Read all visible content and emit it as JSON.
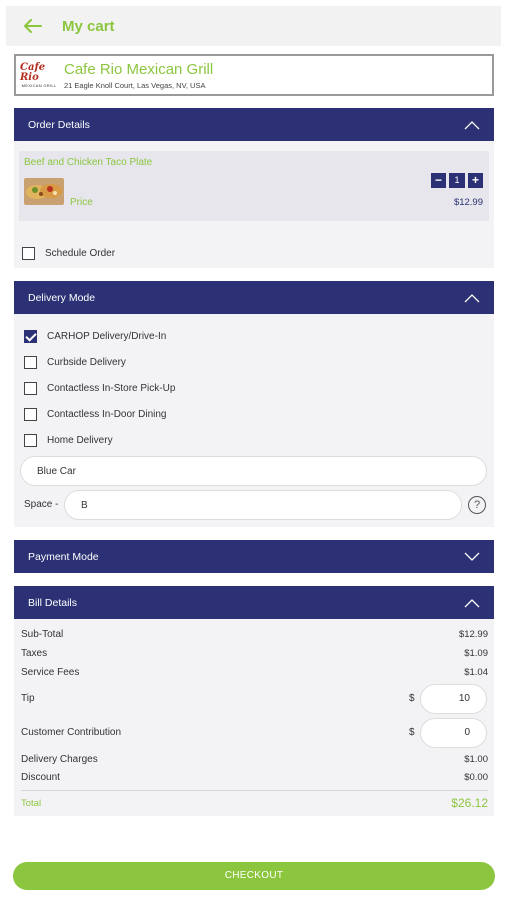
{
  "header": {
    "title": "My cart",
    "back_icon": "arrow-left-icon"
  },
  "store": {
    "logo_text": "Cafe Rio",
    "logo_sub": "MEXICAN GRILL",
    "name": "Cafe Rio Mexican Grill",
    "address": "21 Eagle Knoll Court, Las Vegas, NV, USA"
  },
  "order_details": {
    "title": "Order Details",
    "item": {
      "name": "Beef and Chicken Taco Plate",
      "price_label": "Price",
      "quantity": "1",
      "price": "$12.99",
      "minus": "−",
      "plus": "+"
    },
    "schedule_label": "Schedule Order"
  },
  "delivery_mode": {
    "title": "Delivery Mode",
    "options": [
      {
        "label": "CARHOP Delivery/Drive-In",
        "checked": true
      },
      {
        "label": "Curbside Delivery",
        "checked": false
      },
      {
        "label": "Contactless In-Store Pick-Up",
        "checked": false
      },
      {
        "label": "Contactless In-Door Dining",
        "checked": false
      },
      {
        "label": "Home Delivery",
        "checked": false
      }
    ],
    "vehicle_value": "Blue Car",
    "space_label": "Space -",
    "space_value": "B",
    "help": "?"
  },
  "payment_mode": {
    "title": "Payment Mode"
  },
  "bill_details": {
    "title": "Bill Details",
    "subtotal_label": "Sub-Total",
    "subtotal": "$12.99",
    "taxes_label": "Taxes",
    "taxes": "$1.09",
    "service_label": "Service Fees",
    "service": "$1.04",
    "tip_label": "Tip",
    "tip_currency": "$",
    "tip_value": "10",
    "contribution_label": "Customer Contribution",
    "contribution_currency": "$",
    "contribution_value": "0",
    "delivery_label": "Delivery Charges",
    "delivery": "$1.00",
    "discount_label": "Discount",
    "discount": "$0.00",
    "total_label": "Total",
    "total": "$26.12"
  },
  "checkout_label": "CHECKOUT",
  "colors": {
    "accent_green": "#8cc63f",
    "navy": "#2b3174"
  }
}
